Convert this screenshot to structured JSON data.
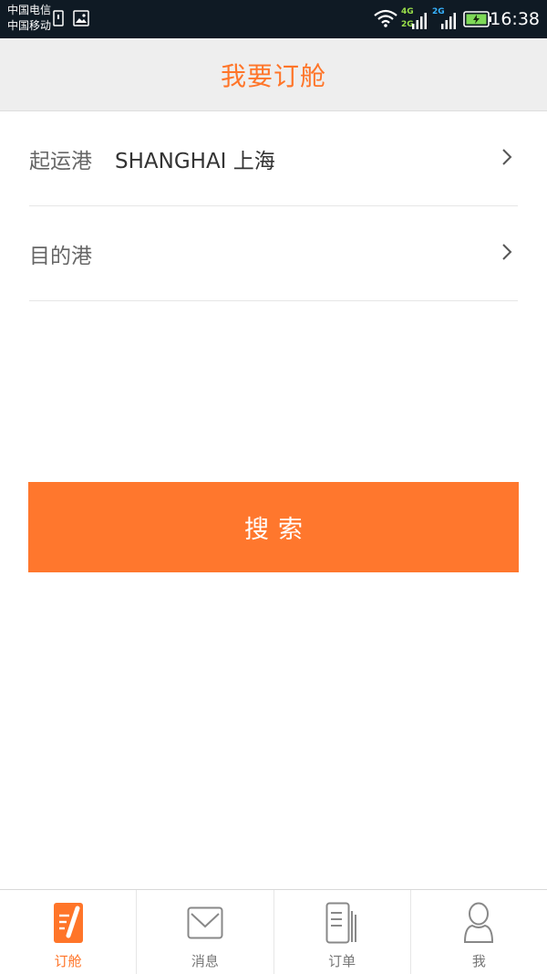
{
  "status_bar": {
    "carrier_1": "中国电信",
    "carrier_2": "中国移动",
    "net_4g": "4G",
    "net_2g_a": "2G",
    "net_2g_b": "2G",
    "time": "16:38"
  },
  "header": {
    "title": "我要订舱"
  },
  "form": {
    "origin_label": "起运港",
    "origin_value": "SHANGHAI 上海",
    "destination_label": "目的港",
    "destination_value": ""
  },
  "search_button_label": "搜索",
  "tabs": [
    {
      "label": "订舱",
      "icon": "booking-icon",
      "active": true
    },
    {
      "label": "消息",
      "icon": "message-icon",
      "active": false
    },
    {
      "label": "订单",
      "icon": "order-icon",
      "active": false
    },
    {
      "label": "我",
      "icon": "profile-icon",
      "active": false
    }
  ],
  "colors": {
    "accent": "#ff7529",
    "button": "#ff772d",
    "status_bar": "#0f1a24",
    "header_bg": "#eeeeee"
  }
}
